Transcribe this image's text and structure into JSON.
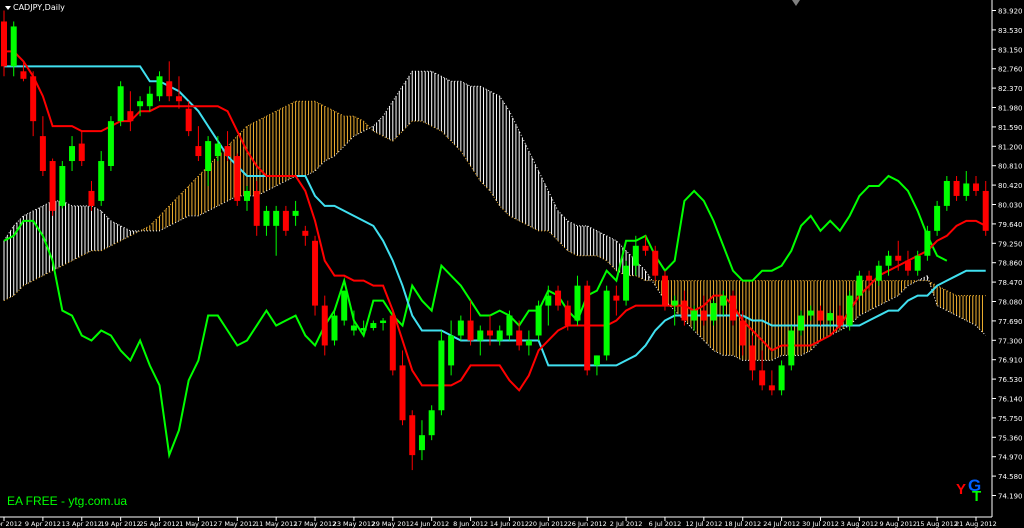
{
  "window": {
    "title": "CADJPY,Daily"
  },
  "watermark": {
    "text": "EA FREE - ytg.com.ua",
    "logo_text": "YGT"
  },
  "chart_data": {
    "type": "candlestick",
    "symbol": "CADJPY",
    "timeframe": "Daily",
    "ylim": [
      74.18,
      84.05
    ],
    "y_ticks": [
      "83.920",
      "83.530",
      "83.150",
      "82.760",
      "82.370",
      "81.980",
      "81.590",
      "81.200",
      "80.810",
      "80.420",
      "80.030",
      "79.640",
      "79.250",
      "78.860",
      "78.470",
      "78.080",
      "77.690",
      "77.300",
      "76.910",
      "76.530",
      "76.140",
      "75.750",
      "75.360",
      "74.970",
      "74.580",
      "74.190"
    ],
    "x_ticks": [
      {
        "i": 0,
        "label": "3 Apr 2012"
      },
      {
        "i": 4,
        "label": "9 Apr 2012"
      },
      {
        "i": 8,
        "label": "13 Apr 2012"
      },
      {
        "i": 12,
        "label": "19 Apr 2012"
      },
      {
        "i": 16,
        "label": "25 Apr 2012"
      },
      {
        "i": 20,
        "label": "1 May 2012"
      },
      {
        "i": 24,
        "label": "7 May 2012"
      },
      {
        "i": 28,
        "label": "11 May 2012"
      },
      {
        "i": 32,
        "label": "17 May 2012"
      },
      {
        "i": 36,
        "label": "23 May 2012"
      },
      {
        "i": 40,
        "label": "29 May 2012"
      },
      {
        "i": 44,
        "label": "4 Jun 2012"
      },
      {
        "i": 48,
        "label": "8 Jun 2012"
      },
      {
        "i": 52,
        "label": "14 Jun 2012"
      },
      {
        "i": 56,
        "label": "20 Jun 2012"
      },
      {
        "i": 60,
        "label": "26 Jun 2012"
      },
      {
        "i": 64,
        "label": "2 Jul 2012"
      },
      {
        "i": 68,
        "label": "6 Jul 2012"
      },
      {
        "i": 72,
        "label": "12 Jul 2012"
      },
      {
        "i": 76,
        "label": "18 Jul 2012"
      },
      {
        "i": 80,
        "label": "24 Jul 2012"
      },
      {
        "i": 84,
        "label": "30 Jul 2012"
      },
      {
        "i": 88,
        "label": "3 Aug 2012"
      },
      {
        "i": 92,
        "label": "9 Aug 2012"
      },
      {
        "i": 96,
        "label": "15 Aug 2012"
      },
      {
        "i": 100,
        "label": "21 Aug 2012"
      }
    ],
    "colors": {
      "bull": "#00ff00",
      "bear": "#ff0000",
      "tenkan": "#ff0000",
      "kijun": "#40e0f0",
      "chikou": "#00ff00",
      "cloud_bear": "#f0b030",
      "cloud_bull": "#ffffff",
      "axis": "#ffffff",
      "grid": "#404040"
    },
    "candles": [
      [
        83.7,
        83.92,
        82.6,
        82.8
      ],
      [
        82.8,
        83.7,
        82.6,
        83.6
      ],
      [
        82.7,
        82.9,
        82.5,
        82.55
      ],
      [
        82.6,
        82.7,
        81.4,
        81.7
      ],
      [
        81.4,
        81.8,
        80.6,
        80.7
      ],
      [
        80.9,
        80.95,
        79.8,
        79.9
      ],
      [
        80.0,
        80.9,
        79.95,
        80.8
      ],
      [
        80.9,
        81.4,
        80.7,
        81.2
      ],
      [
        81.25,
        81.5,
        80.8,
        80.9
      ],
      [
        80.3,
        80.5,
        79.9,
        80.0
      ],
      [
        80.1,
        81.1,
        80.0,
        80.9
      ],
      [
        80.8,
        81.8,
        80.7,
        81.7
      ],
      [
        81.7,
        82.5,
        81.6,
        82.4
      ],
      [
        81.9,
        82.3,
        81.5,
        81.7
      ],
      [
        82.0,
        82.2,
        81.8,
        82.1
      ],
      [
        82.0,
        82.4,
        81.9,
        82.25
      ],
      [
        82.2,
        82.7,
        82.1,
        82.6
      ],
      [
        82.5,
        82.9,
        82.1,
        82.2
      ],
      [
        82.2,
        82.6,
        81.95,
        82.1
      ],
      [
        81.95,
        82.1,
        81.4,
        81.5
      ],
      [
        81.2,
        81.6,
        80.9,
        81.0
      ],
      [
        80.7,
        81.4,
        80.4,
        81.3
      ],
      [
        81.0,
        81.4,
        80.9,
        81.25
      ],
      [
        81.2,
        81.5,
        80.9,
        81.0
      ],
      [
        81.0,
        81.05,
        80.0,
        80.1
      ],
      [
        80.1,
        80.4,
        79.9,
        80.3
      ],
      [
        80.3,
        80.5,
        79.4,
        79.6
      ],
      [
        79.6,
        80.0,
        79.4,
        79.9
      ],
      [
        79.6,
        80.0,
        79.0,
        79.9
      ],
      [
        79.9,
        80.0,
        79.4,
        79.5
      ],
      [
        79.8,
        80.1,
        79.6,
        79.9
      ],
      [
        79.5,
        79.6,
        79.2,
        79.4
      ],
      [
        79.3,
        79.4,
        77.8,
        78.0
      ],
      [
        78.0,
        78.2,
        77.0,
        77.2
      ],
      [
        77.3,
        77.9,
        77.2,
        77.8
      ],
      [
        77.7,
        78.3,
        77.6,
        78.3
      ],
      [
        77.5,
        77.9,
        77.4,
        77.6
      ],
      [
        77.5,
        77.7,
        77.4,
        77.55
      ],
      [
        77.55,
        77.7,
        77.5,
        77.65
      ],
      [
        77.65,
        77.75,
        77.5,
        77.7
      ],
      [
        77.8,
        77.9,
        76.6,
        76.7
      ],
      [
        76.8,
        77.1,
        75.6,
        75.7
      ],
      [
        75.8,
        75.9,
        74.7,
        75.0
      ],
      [
        75.1,
        75.7,
        74.9,
        75.4
      ],
      [
        75.4,
        76.0,
        75.3,
        75.9
      ],
      [
        75.9,
        77.5,
        75.8,
        77.3
      ],
      [
        76.8,
        77.7,
        76.6,
        77.4
      ],
      [
        77.4,
        77.8,
        77.3,
        77.7
      ],
      [
        77.7,
        78.1,
        77.2,
        77.3
      ],
      [
        77.3,
        77.6,
        77.0,
        77.5
      ],
      [
        77.5,
        77.8,
        77.2,
        77.4
      ],
      [
        77.3,
        77.6,
        77.2,
        77.5
      ],
      [
        77.4,
        77.9,
        77.3,
        77.8
      ],
      [
        77.5,
        77.7,
        77.1,
        77.2
      ],
      [
        77.2,
        77.5,
        77.0,
        77.3
      ],
      [
        77.4,
        78.1,
        77.3,
        78.0
      ],
      [
        78.0,
        78.4,
        77.6,
        78.2
      ],
      [
        78.3,
        78.4,
        77.9,
        78.0
      ],
      [
        78.0,
        78.1,
        77.5,
        77.6
      ],
      [
        77.7,
        78.6,
        77.6,
        78.4
      ],
      [
        78.4,
        78.5,
        76.6,
        76.7
      ],
      [
        76.8,
        77.0,
        76.6,
        77.0
      ],
      [
        77.0,
        78.4,
        76.9,
        78.3
      ],
      [
        78.2,
        78.4,
        77.8,
        78.1
      ],
      [
        78.1,
        78.9,
        78.0,
        78.8
      ],
      [
        78.8,
        79.4,
        78.6,
        79.2
      ],
      [
        79.2,
        79.4,
        79.0,
        79.1
      ],
      [
        79.1,
        79.2,
        78.5,
        78.6
      ],
      [
        78.6,
        78.7,
        77.9,
        78.0
      ],
      [
        78.0,
        78.2,
        77.6,
        78.1
      ],
      [
        78.1,
        78.3,
        77.6,
        77.7
      ],
      [
        77.7,
        78.0,
        77.5,
        77.9
      ],
      [
        77.9,
        78.2,
        77.6,
        77.7
      ],
      [
        77.7,
        78.1,
        77.6,
        78.05
      ],
      [
        78.0,
        78.3,
        77.8,
        78.2
      ],
      [
        78.2,
        78.3,
        77.6,
        77.7
      ],
      [
        77.7,
        77.9,
        77.0,
        77.2
      ],
      [
        77.2,
        77.4,
        76.5,
        76.7
      ],
      [
        76.7,
        77.1,
        76.3,
        76.4
      ],
      [
        76.4,
        76.7,
        76.2,
        76.3
      ],
      [
        76.3,
        76.9,
        76.2,
        76.8
      ],
      [
        76.8,
        77.6,
        76.7,
        77.5
      ],
      [
        77.5,
        77.9,
        77.4,
        77.8
      ],
      [
        77.8,
        78.0,
        77.7,
        77.9
      ],
      [
        77.9,
        78.0,
        77.6,
        77.7
      ],
      [
        77.7,
        77.9,
        77.6,
        77.85
      ],
      [
        77.8,
        78.0,
        77.55,
        77.6
      ],
      [
        77.6,
        78.3,
        77.5,
        78.2
      ],
      [
        78.2,
        78.7,
        78.1,
        78.6
      ],
      [
        78.6,
        78.7,
        78.3,
        78.5
      ],
      [
        78.5,
        78.9,
        78.4,
        78.8
      ],
      [
        78.8,
        79.1,
        78.6,
        79.0
      ],
      [
        79.0,
        79.3,
        78.7,
        78.9
      ],
      [
        78.9,
        79.1,
        78.6,
        78.7
      ],
      [
        78.7,
        79.1,
        78.6,
        79.0
      ],
      [
        79.0,
        79.6,
        78.9,
        79.5
      ],
      [
        79.5,
        80.1,
        79.4,
        80.0
      ],
      [
        80.0,
        80.6,
        79.9,
        80.5
      ],
      [
        80.5,
        80.6,
        80.1,
        80.2
      ],
      [
        80.2,
        80.7,
        80.1,
        80.45
      ],
      [
        80.45,
        80.6,
        80.2,
        80.3
      ],
      [
        80.3,
        80.5,
        79.4,
        79.5
      ]
    ],
    "tenkan": [
      83.1,
      83.1,
      82.9,
      82.6,
      82.2,
      81.6,
      81.6,
      81.6,
      81.5,
      81.5,
      81.5,
      81.6,
      81.7,
      81.7,
      81.9,
      81.9,
      82.0,
      82.0,
      82.0,
      82.0,
      82.0,
      82.0,
      82.0,
      81.9,
      81.5,
      81.1,
      80.8,
      80.6,
      80.6,
      80.6,
      80.6,
      80.3,
      79.7,
      78.9,
      78.6,
      78.6,
      78.5,
      78.5,
      78.4,
      78.4,
      77.9,
      77.3,
      76.7,
      76.4,
      76.4,
      76.4,
      76.4,
      76.5,
      76.8,
      76.8,
      76.8,
      76.8,
      76.5,
      76.3,
      76.6,
      77.1,
      77.3,
      77.5,
      77.6,
      77.6,
      77.6,
      77.6,
      77.6,
      77.7,
      77.9,
      78.0,
      78.0,
      78.0,
      78.0,
      78.0,
      78.0,
      77.9,
      78.0,
      78.2,
      78.2,
      78.0,
      77.7,
      77.5,
      77.3,
      77.1,
      77.2,
      77.2,
      77.2,
      77.2,
      77.3,
      77.4,
      77.6,
      77.9,
      78.2,
      78.4,
      78.6,
      78.7,
      78.8,
      78.9,
      79.0,
      79.1,
      79.3,
      79.4,
      79.6,
      79.7,
      79.7,
      79.6
    ],
    "kijun": [
      82.8,
      82.8,
      82.8,
      82.8,
      82.8,
      82.8,
      82.8,
      82.8,
      82.8,
      82.8,
      82.8,
      82.8,
      82.8,
      82.8,
      82.8,
      82.5,
      82.5,
      82.4,
      82.3,
      82.1,
      81.9,
      81.6,
      81.3,
      81.0,
      80.8,
      80.6,
      80.6,
      80.6,
      80.6,
      80.6,
      80.6,
      80.6,
      80.2,
      80.0,
      80.0,
      79.9,
      79.8,
      79.7,
      79.6,
      79.3,
      78.9,
      78.4,
      77.8,
      77.5,
      77.5,
      77.5,
      77.4,
      77.3,
      77.3,
      77.3,
      77.3,
      77.3,
      77.3,
      77.3,
      77.3,
      77.3,
      76.8,
      76.8,
      76.8,
      76.8,
      76.8,
      76.8,
      76.8,
      76.8,
      76.9,
      77.0,
      77.2,
      77.5,
      77.7,
      77.8,
      77.8,
      77.8,
      77.8,
      77.8,
      77.8,
      77.8,
      77.8,
      77.7,
      77.7,
      77.6,
      77.6,
      77.6,
      77.6,
      77.6,
      77.6,
      77.6,
      77.6,
      77.6,
      77.6,
      77.7,
      77.8,
      77.9,
      77.9,
      78.1,
      78.2,
      78.2,
      78.4,
      78.5,
      78.6,
      78.7,
      78.7,
      78.7
    ],
    "chikou": [
      79.3,
      79.4,
      79.7,
      79.7,
      79.4,
      78.9,
      77.9,
      77.8,
      77.4,
      77.3,
      77.5,
      77.4,
      77.1,
      76.9,
      77.3,
      76.8,
      76.4,
      75.0,
      75.5,
      76.5,
      76.9,
      77.8,
      77.8,
      77.5,
      77.2,
      77.3,
      77.6,
      77.9,
      77.6,
      77.7,
      77.8,
      77.4,
      77.2,
      77.6,
      77.9,
      78.5,
      77.7,
      77.4,
      78.1,
      78.1,
      77.8,
      77.6,
      78.4,
      78.1,
      77.9,
      78.8,
      78.6,
      78.4,
      78.1,
      77.8,
      77.8,
      77.9,
      77.8,
      77.6,
      77.9,
      77.9,
      78.3,
      78.2,
      77.9,
      77.7,
      78.2,
      78.3,
      78.7,
      78.5,
      79.3,
      79.3,
      79.4,
      79.0,
      78.7,
      78.9,
      80.1,
      80.3,
      80.1,
      79.7,
      79.2,
      78.7,
      78.5,
      78.5,
      78.7,
      78.7,
      78.8,
      79.1,
      79.6,
      79.8,
      79.5,
      79.7,
      79.5,
      79.8,
      80.2,
      80.4,
      80.4,
      80.6,
      80.5,
      80.3,
      79.9,
      79.4,
      79.0,
      78.9
    ],
    "span_a": [
      79.3,
      79.6,
      79.8,
      79.9,
      80.0,
      80.1,
      80.1,
      80.0,
      80.0,
      80.0,
      79.9,
      79.7,
      79.6,
      79.5,
      79.5,
      79.5,
      79.5,
      79.6,
      79.7,
      79.8,
      79.8,
      79.9,
      80.0,
      80.1,
      80.2,
      80.2,
      80.2,
      80.3,
      80.4,
      80.5,
      80.6,
      80.6,
      80.7,
      80.9,
      81.0,
      81.2,
      81.4,
      81.5,
      81.6,
      81.8,
      82.1,
      82.4,
      82.7,
      82.7,
      82.7,
      82.6,
      82.5,
      82.5,
      82.4,
      82.4,
      82.3,
      82.2,
      81.9,
      81.5,
      81.1,
      80.7,
      80.3,
      79.9,
      79.7,
      79.6,
      79.6,
      79.5,
      79.4,
      79.3,
      79.1,
      78.9,
      78.7,
      78.4,
      78.1,
      77.9,
      77.7,
      77.5,
      77.3,
      77.1,
      77.0,
      77.0,
      76.9,
      76.9,
      76.9,
      76.9,
      77.0,
      77.0,
      77.0,
      77.1,
      77.3,
      77.4,
      77.5,
      77.6,
      77.8,
      77.9,
      78.0,
      78.1,
      78.2,
      78.4,
      78.5,
      78.6,
      78.0,
      77.9,
      77.8,
      77.7,
      77.6,
      77.4
    ],
    "span_b": [
      78.1,
      78.2,
      78.4,
      78.5,
      78.6,
      78.7,
      78.8,
      78.9,
      79.0,
      79.1,
      79.1,
      79.2,
      79.3,
      79.4,
      79.5,
      79.6,
      79.8,
      80.0,
      80.2,
      80.4,
      80.6,
      80.8,
      81.0,
      81.2,
      81.4,
      81.6,
      81.7,
      81.8,
      81.9,
      82.0,
      82.1,
      82.1,
      82.1,
      82.0,
      81.9,
      81.8,
      81.8,
      81.7,
      81.5,
      81.4,
      81.3,
      81.5,
      81.7,
      81.7,
      81.6,
      81.5,
      81.3,
      81.1,
      80.8,
      80.5,
      80.3,
      80.0,
      79.8,
      79.7,
      79.6,
      79.5,
      79.5,
      79.3,
      79.1,
      79.0,
      79.0,
      79.0,
      78.9,
      78.7,
      78.6,
      78.6,
      78.5,
      78.5,
      78.5,
      78.5,
      78.5,
      78.5,
      78.5,
      78.5,
      78.5,
      78.5,
      78.5,
      78.5,
      78.5,
      78.5,
      78.5,
      78.5,
      78.5,
      78.5,
      78.5,
      78.5,
      78.5,
      78.5,
      78.5,
      78.5,
      78.5,
      78.5,
      78.5,
      78.5,
      78.5,
      78.5,
      78.4,
      78.3,
      78.2,
      78.2,
      78.2,
      78.2
    ]
  }
}
